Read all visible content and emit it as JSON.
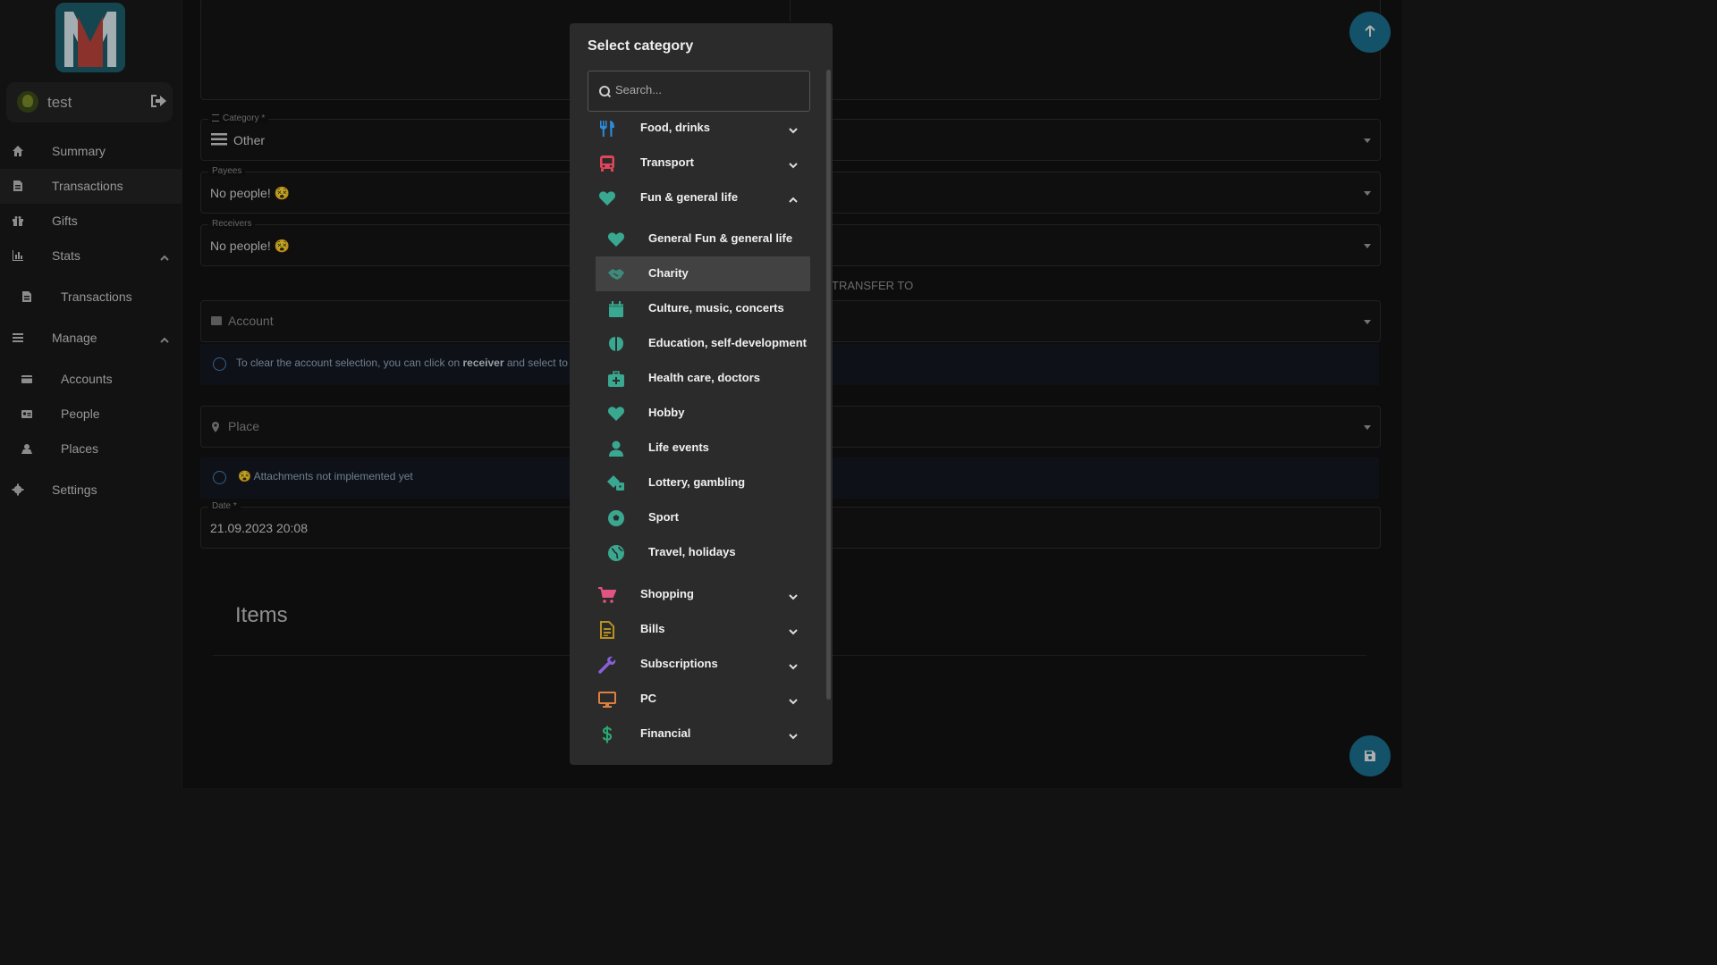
{
  "colors": {
    "accent_fab": "#1a6e8c",
    "food": "#2d8ad8",
    "transport": "#e0455a",
    "heart": "#3aa890",
    "shopping": "#e05580",
    "bills": "#b79020",
    "subscriptions": "#8860d8",
    "pc": "#e08040",
    "financial": "#2aa870"
  },
  "user": {
    "name": "test"
  },
  "sidebar": {
    "items": [
      {
        "label": "Summary",
        "icon": "home-icon"
      },
      {
        "label": "Transactions",
        "icon": "receipt-icon"
      },
      {
        "label": "Gifts",
        "icon": "gift-icon"
      },
      {
        "label": "Stats",
        "icon": "chart-icon"
      },
      {
        "label": "Transactions",
        "icon": "receipt-icon"
      },
      {
        "label": "Manage",
        "icon": "menu-icon"
      },
      {
        "label": "Accounts",
        "icon": "wallet-icon"
      },
      {
        "label": "People",
        "icon": "id-card-icon"
      },
      {
        "label": "Places",
        "icon": "map-icon"
      },
      {
        "label": "Settings",
        "icon": "gear-icon"
      }
    ]
  },
  "form": {
    "category": {
      "legend": "Category *",
      "value": "Other"
    },
    "payees": {
      "legend": "Payees",
      "value": "No people! 😵"
    },
    "receivers": {
      "legend": "Receivers",
      "value": "No people! 😵"
    },
    "transfer_to": "TRANSFER TO",
    "account": {
      "placeholder": "Account"
    },
    "account_info": {
      "before": "To clear the account selection, you can click on ",
      "strong": "receiver",
      "after": " and select to cl"
    },
    "place": {
      "placeholder": "Place"
    },
    "attachments_info": "😵 Attachments not implemented yet",
    "date": {
      "legend": "Date *",
      "value": "21.09.2023 20:08"
    },
    "items_heading": "Items"
  },
  "dialog": {
    "title": "Select category",
    "search_placeholder": "Search...",
    "categories": [
      {
        "label": "Food, drinks",
        "expanded": false
      },
      {
        "label": "Transport",
        "expanded": false
      },
      {
        "label": "Fun & general life",
        "expanded": true
      },
      {
        "label": "Shopping",
        "expanded": false
      },
      {
        "label": "Bills",
        "expanded": false
      },
      {
        "label": "Subscriptions",
        "expanded": false
      },
      {
        "label": "PC",
        "expanded": false
      },
      {
        "label": "Financial",
        "expanded": false
      }
    ],
    "subcategories": [
      {
        "label": "General Fun & general life",
        "selected": false
      },
      {
        "label": "Charity",
        "selected": true
      },
      {
        "label": "Culture, music, concerts",
        "selected": false
      },
      {
        "label": "Education, self-development",
        "selected": false
      },
      {
        "label": "Health care, doctors",
        "selected": false
      },
      {
        "label": "Hobby",
        "selected": false
      },
      {
        "label": "Life events",
        "selected": false
      },
      {
        "label": "Lottery, gambling",
        "selected": false
      },
      {
        "label": "Sport",
        "selected": false
      },
      {
        "label": "Travel, holidays",
        "selected": false
      }
    ]
  }
}
